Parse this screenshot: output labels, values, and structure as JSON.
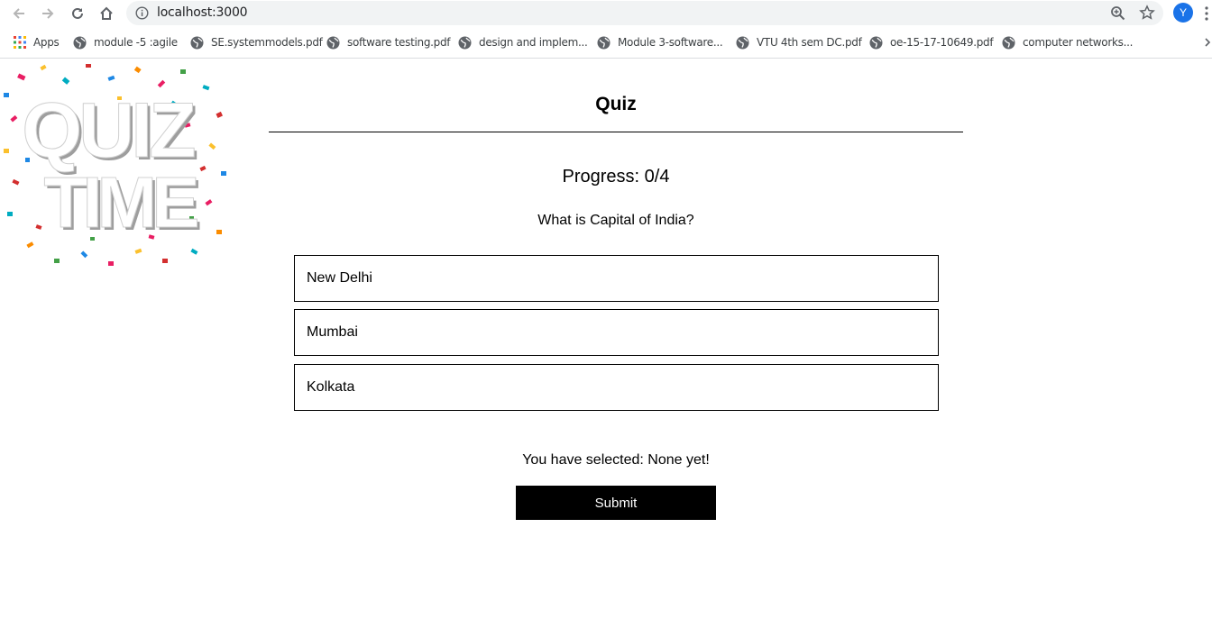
{
  "browser": {
    "url": "localhost:3000",
    "profile_initial": "Y",
    "profile_color": "#1a73e8"
  },
  "bookmarks": [
    {
      "label": "Apps",
      "icon": "apps-grid-icon"
    },
    {
      "label": "module -5 :agile",
      "icon": "globe-icon"
    },
    {
      "label": "SE.systemmodels.pdf",
      "icon": "globe-icon"
    },
    {
      "label": "software testing.pdf",
      "icon": "globe-icon"
    },
    {
      "label": "design and implem...",
      "icon": "globe-icon"
    },
    {
      "label": "Module 3-software...",
      "icon": "globe-icon"
    },
    {
      "label": "VTU 4th sem DC.pdf",
      "icon": "globe-icon"
    },
    {
      "label": "oe-15-17-10649.pdf",
      "icon": "globe-icon"
    },
    {
      "label": "computer networks...",
      "icon": "globe-icon"
    }
  ],
  "logo": {
    "line1": "QUIZ",
    "line2": "TIME"
  },
  "quiz": {
    "title": "Quiz",
    "progress": "Progress: 0/4",
    "question": "What is Capital of India?",
    "options": [
      "New Delhi",
      "Mumbai",
      "Kolkata"
    ],
    "selected_text": "You have selected: None yet!",
    "submit_label": "Submit"
  }
}
